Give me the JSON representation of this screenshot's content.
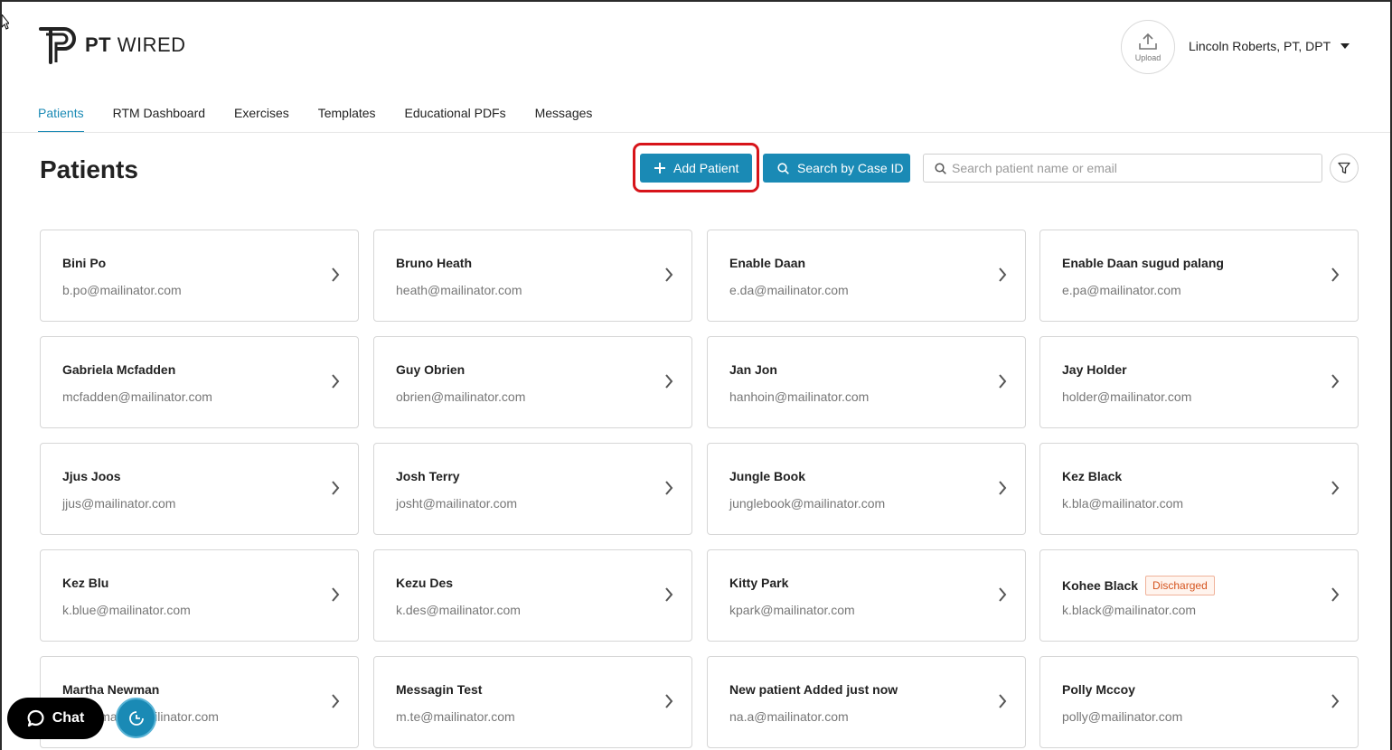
{
  "brand": {
    "bold": "PT",
    "rest": " WIRED"
  },
  "header": {
    "upload_label": "Upload",
    "user_name": "Lincoln Roberts, PT, DPT"
  },
  "nav": [
    {
      "label": "Patients",
      "active": true
    },
    {
      "label": "RTM Dashboard",
      "active": false
    },
    {
      "label": "Exercises",
      "active": false
    },
    {
      "label": "Templates",
      "active": false
    },
    {
      "label": "Educational PDFs",
      "active": false
    },
    {
      "label": "Messages",
      "active": false
    }
  ],
  "page": {
    "title": "Patients",
    "add_patient_label": "Add Patient",
    "search_case_label": "Search by Case ID",
    "search_placeholder": "Search patient name or email",
    "search_value": ""
  },
  "patients": [
    {
      "name": "Bini Po",
      "email": "b.po@mailinator.com"
    },
    {
      "name": "Bruno Heath",
      "email": "heath@mailinator.com"
    },
    {
      "name": "Enable Daan",
      "email": "e.da@mailinator.com"
    },
    {
      "name": "Enable Daan sugud palang",
      "email": "e.pa@mailinator.com"
    },
    {
      "name": "Gabriela Mcfadden",
      "email": "mcfadden@mailinator.com"
    },
    {
      "name": "Guy Obrien",
      "email": "obrien@mailinator.com"
    },
    {
      "name": "Jan Jon",
      "email": "hanhoin@mailinator.com"
    },
    {
      "name": "Jay Holder",
      "email": "holder@mailinator.com"
    },
    {
      "name": "Jjus Joos",
      "email": "jjus@mailinator.com"
    },
    {
      "name": "Josh Terry",
      "email": "josht@mailinator.com"
    },
    {
      "name": "Jungle Book",
      "email": "junglebook@mailinator.com"
    },
    {
      "name": "Kez Black",
      "email": "k.bla@mailinator.com"
    },
    {
      "name": "Kez Blu",
      "email": "k.blue@mailinator.com"
    },
    {
      "name": "Kezu Des",
      "email": "k.des@mailinator.com"
    },
    {
      "name": "Kitty Park",
      "email": "kpark@mailinator.com"
    },
    {
      "name": "Kohee Black",
      "email": "k.black@mailinator.com",
      "badge": "Discharged"
    },
    {
      "name": "Martha Newman",
      "email": "m.newman@mailinator.com"
    },
    {
      "name": "Messagin Test",
      "email": "m.te@mailinator.com"
    },
    {
      "name": "New patient Added just now",
      "email": "na.a@mailinator.com"
    },
    {
      "name": "Polly Mccoy",
      "email": "polly@mailinator.com"
    }
  ],
  "widgets": {
    "chat_label": "Chat"
  },
  "colors": {
    "primary": "#1a8ab5",
    "highlight": "#d7141a",
    "discharged": "#d5541e"
  },
  "icons": [
    "logo-icon",
    "upload-icon",
    "caret-down-icon",
    "plus-icon",
    "search-icon",
    "filter-icon",
    "chevron-right-icon",
    "chat-bubble-icon",
    "pendo-icon"
  ]
}
